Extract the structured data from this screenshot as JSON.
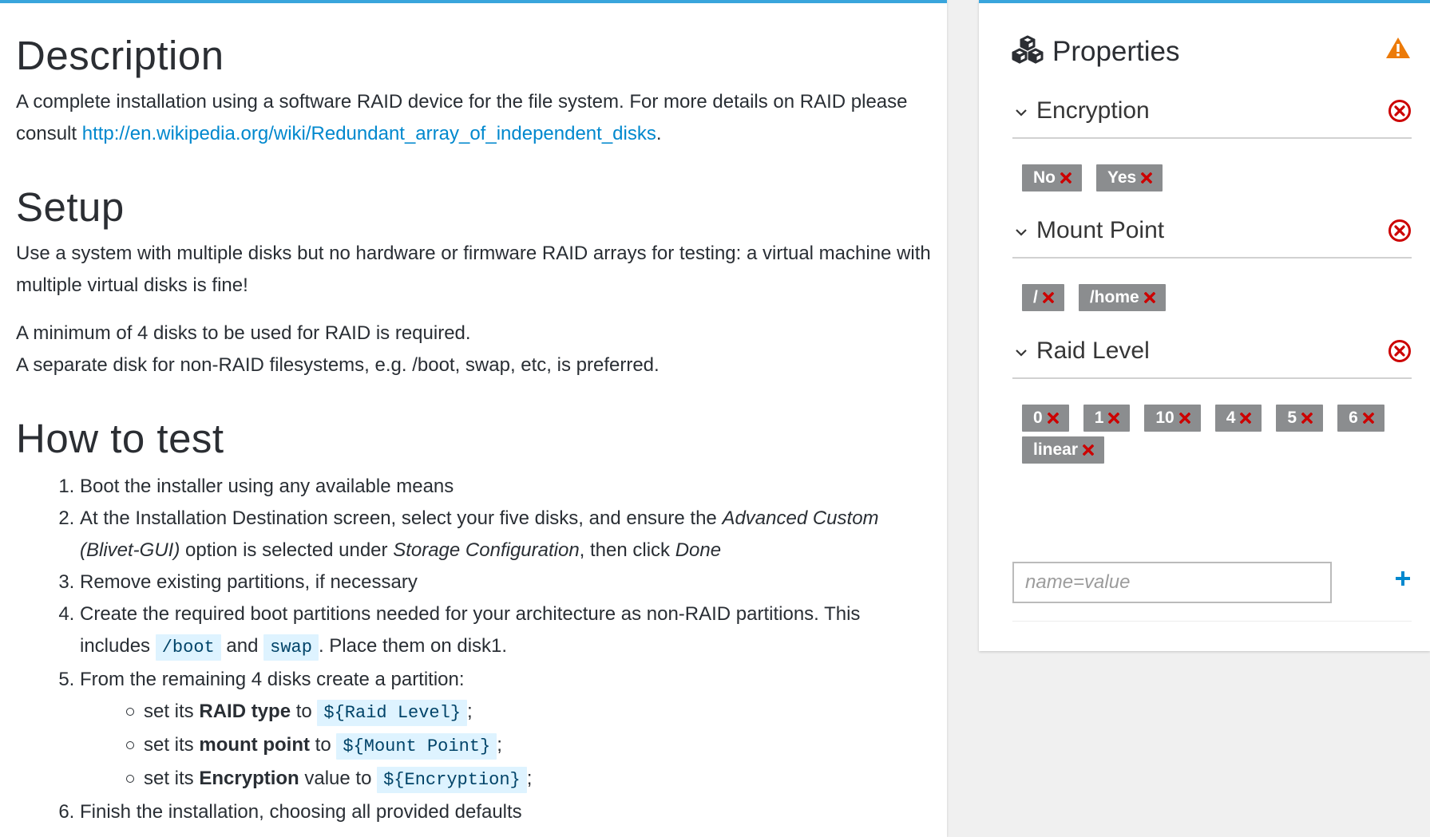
{
  "description": {
    "heading": "Description",
    "text_before_link": "A complete installation using a software RAID device for the file system. For more details on RAID please consult ",
    "link_text": "http://en.wikipedia.org/wiki/Redundant_array_of_independent_disks",
    "text_after_link": "."
  },
  "setup": {
    "heading": "Setup",
    "para1": "Use a system with multiple disks but no hardware or firmware RAID arrays for testing: a virtual machine with multiple virtual disks is fine!",
    "para2_line1": "A minimum of 4 disks to be used for RAID is required.",
    "para2_line2": "A separate disk for non-RAID filesystems, e.g. /boot, swap, etc, is preferred."
  },
  "howto": {
    "heading": "How to test",
    "step1": "Boot the installer using any available means",
    "step2": {
      "a": "At the Installation Destination screen, select your five disks, and ensure the ",
      "em1": "Advanced Custom (Blivet-GUI)",
      "b": " option is selected under ",
      "em2": "Storage Configuration",
      "c": ", then click ",
      "em3": "Done"
    },
    "step3": "Remove existing partitions, if necessary",
    "step4": {
      "a": "Create the required boot partitions needed for your architecture as non-RAID partitions. This includes ",
      "code1": "/boot",
      "b": " and ",
      "code2": "swap",
      "c": ". Place them on disk1."
    },
    "step5": {
      "text": "From the remaining 4 disks create a partition:",
      "sub": [
        {
          "pre": "set its ",
          "bold": "RAID type",
          "mid": " to ",
          "code": "${Raid Level}",
          "post": ";"
        },
        {
          "pre": "set its ",
          "bold": "mount point",
          "mid": " to ",
          "code": "${Mount Point}",
          "post": ";"
        },
        {
          "pre": "set its ",
          "bold": "Encryption",
          "mid": " value to ",
          "code": "${Encryption}",
          "post": ";"
        }
      ]
    },
    "step6": "Finish the installation, choosing all provided defaults"
  },
  "properties": {
    "title": "Properties",
    "sections": [
      {
        "title": "Encryption",
        "tags": [
          "No",
          "Yes"
        ]
      },
      {
        "title": "Mount Point",
        "tags": [
          "/",
          "/home"
        ]
      },
      {
        "title": "Raid Level",
        "tags": [
          "0",
          "1",
          "10",
          "4",
          "5",
          "6",
          "linear"
        ]
      }
    ],
    "input_placeholder": "name=value"
  },
  "colors": {
    "accent": "#39a5dc",
    "link": "#0088ce",
    "warning": "#ec7a08",
    "danger": "#cc0000",
    "tag_bg": "#8b8d8f",
    "code_bg": "#def3ff"
  },
  "icons": {
    "properties": "cubes-icon",
    "warning": "warning-triangle-icon",
    "section_toggle": "chevron-down-icon",
    "section_remove": "remove-circle-icon",
    "tag_remove": "close-icon",
    "add": "plus-icon"
  }
}
